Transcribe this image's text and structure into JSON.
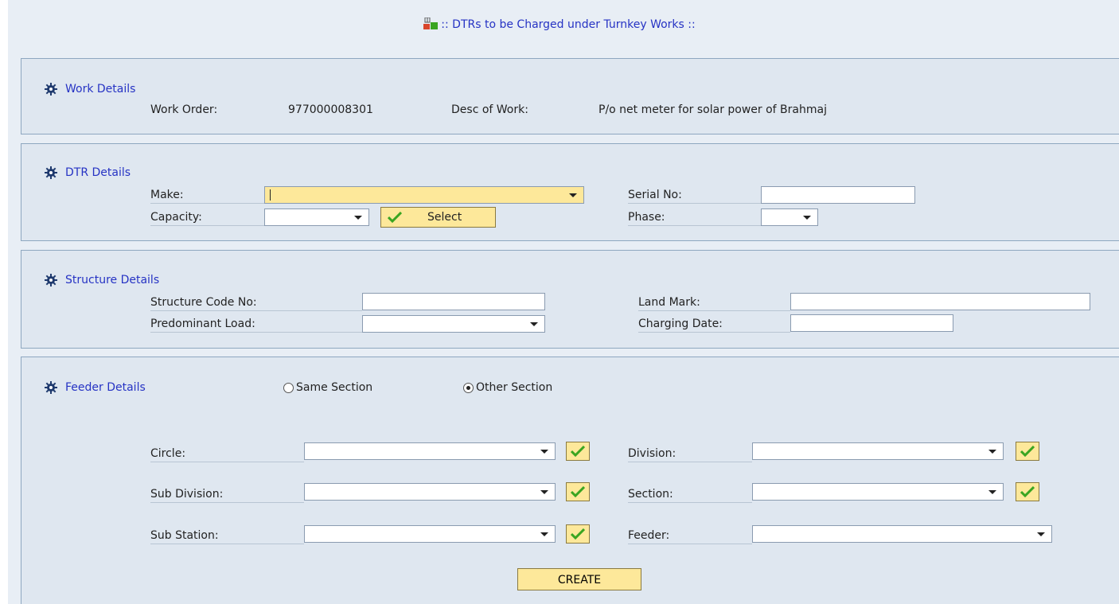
{
  "title": ":: DTRs to be Charged under Turnkey Works ::",
  "work": {
    "heading": "Work Details",
    "work_order_label": "Work Order:",
    "work_order_value": "977000008301",
    "desc_label": "Desc of Work:",
    "desc_value": "P/o net meter for solar power of Brahmaj"
  },
  "dtr": {
    "heading": "DTR Details",
    "make_label": "Make:",
    "capacity_label": "Capacity:",
    "select_button": "Select",
    "serial_label": "Serial No:",
    "phase_label": "Phase:"
  },
  "structure": {
    "heading": "Structure Details",
    "code_label": "Structure Code No:",
    "load_label": "Predominant Load:",
    "landmark_label": "Land Mark:",
    "charging_label": "Charging Date:"
  },
  "feeder": {
    "heading": "Feeder Details",
    "radio_same": "Same Section",
    "radio_other": "Other Section",
    "selected_radio": "Other Section",
    "circle_label": "Circle:",
    "division_label": "Division:",
    "subdivision_label": "Sub Division:",
    "section_label": "Section:",
    "substation_label": "Sub Station:",
    "feeder_label": "Feeder:"
  },
  "create_button": "CREATE",
  "colors": {
    "accent_text": "#2633c4",
    "button_yellow": "#fde89a",
    "panel_bg": "#dfe7f0",
    "check_green": "#3aa521"
  }
}
